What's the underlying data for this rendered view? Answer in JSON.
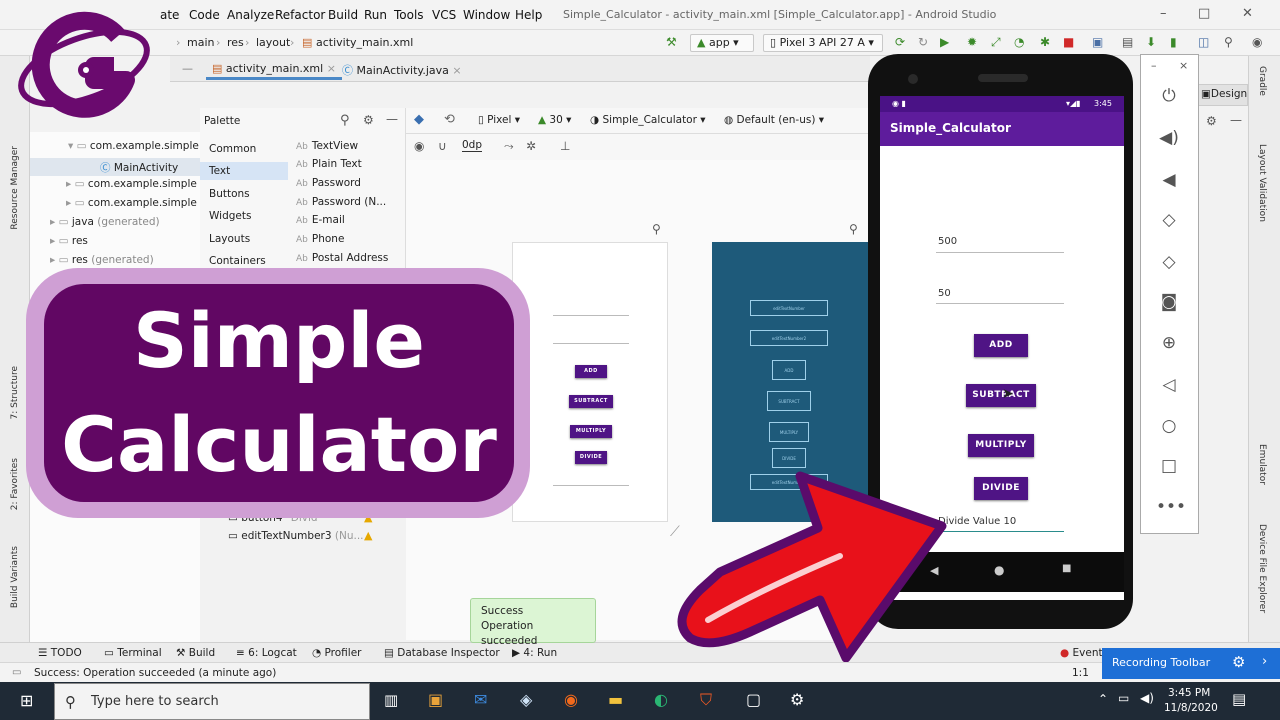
{
  "window": {
    "title": "Simple_Calculator - activity_main.xml [Simple_Calculator.app] - Android Studio",
    "controls": [
      "–",
      "□",
      "✕"
    ]
  },
  "menu": [
    "ate",
    "Code",
    "Analyze",
    "Refactor",
    "Build",
    "Run",
    "Tools",
    "VCS",
    "Window",
    "Help"
  ],
  "breadcrumb": [
    "main",
    "res",
    "layout",
    "activity_main.xml"
  ],
  "toolbar": {
    "run_config": "app",
    "device": "Pixel 3 API 27 A"
  },
  "editor_tabs": [
    {
      "label": "activity_main.xml",
      "active": true
    },
    {
      "label": "MainActivity.java",
      "active": false
    }
  ],
  "left_strip": [
    "Resource Manager",
    "7: Structure",
    "2: Favorites",
    "Build Variants"
  ],
  "project_tree": [
    {
      "label": "com.example.simple",
      "dim": ""
    },
    {
      "label": "MainActivity",
      "dim": ""
    },
    {
      "label": "com.example.simple",
      "dim": ""
    },
    {
      "label": "com.example.simple",
      "dim": ""
    },
    {
      "label": "java",
      "dim": "(generated)"
    },
    {
      "label": "res",
      "dim": ""
    },
    {
      "label": "res",
      "dim": "(generated)"
    }
  ],
  "palette": {
    "title": "Palette",
    "categories": [
      "Common",
      "Text",
      "Buttons",
      "Widgets",
      "Layouts",
      "Containers"
    ],
    "selected_category": "Text",
    "items": [
      "TextView",
      "Plain Text",
      "Password",
      "Password (N...",
      "E-mail",
      "Phone",
      "Postal Address"
    ],
    "item_prefix": "Ab"
  },
  "design_toolbar": {
    "device": "Pixel",
    "api": "30",
    "theme": "Simple_Calculator",
    "locale": "Default (en-us)",
    "margin": "0dp",
    "mode": "Design"
  },
  "component_tree": [
    {
      "label": "button4",
      "detail": "\"Divid"
    },
    {
      "label": "editTextNumber3",
      "detail": "(Nu..."
    }
  ],
  "blueprint_labels": [
    "editTextNumber",
    "editTextNumber2",
    "ADD",
    "SUBTRACT",
    "MULTIPLY",
    "DIVIDE",
    "editTextNumber3"
  ],
  "design_buttons": [
    "ADD",
    "SUBTRACT",
    "MULTIPLY",
    "DIVIDE"
  ],
  "emulator": {
    "time": "3:45",
    "app_title": "Simple_Calculator",
    "input1": "500",
    "input2": "50",
    "buttons": [
      "ADD",
      "SUBTRACT",
      "MULTIPLY",
      "DIVIDE"
    ],
    "result": "Divide Value 10",
    "panel_controls": [
      "power-icon",
      "volume-up-icon",
      "volume-down-icon",
      "rotate-left-icon",
      "rotate-right-icon",
      "camera-icon",
      "zoom-icon",
      "back-icon",
      "home-icon",
      "overview-icon",
      "more-icon"
    ]
  },
  "right_strip": [
    "Gradle",
    "Layout Validation",
    "Emulator",
    "Device File Explorer"
  ],
  "bottom_tools": [
    "TODO",
    "Terminal",
    "Build",
    "6: Logcat",
    "Profiler",
    "Database Inspector",
    "4: Run",
    "Event"
  ],
  "status": "Success: Operation succeeded (a minute ago)",
  "status_pos": "1:1",
  "toast": {
    "title": "Success",
    "message": "Operation succeeded"
  },
  "recording": "Recording Toolbar",
  "taskbar": {
    "search_placeholder": "Type here to search",
    "time": "3:45 PM",
    "date": "11/8/2020"
  },
  "overlay": {
    "line1": "Simple",
    "line2": "Calculator"
  },
  "colors": {
    "accent_purple": "#610763",
    "title_border": "#cf9fd4",
    "app_bar": "#5e1c9c",
    "arrow_red": "#e8111a",
    "arrow_border": "#5a0b6b"
  }
}
